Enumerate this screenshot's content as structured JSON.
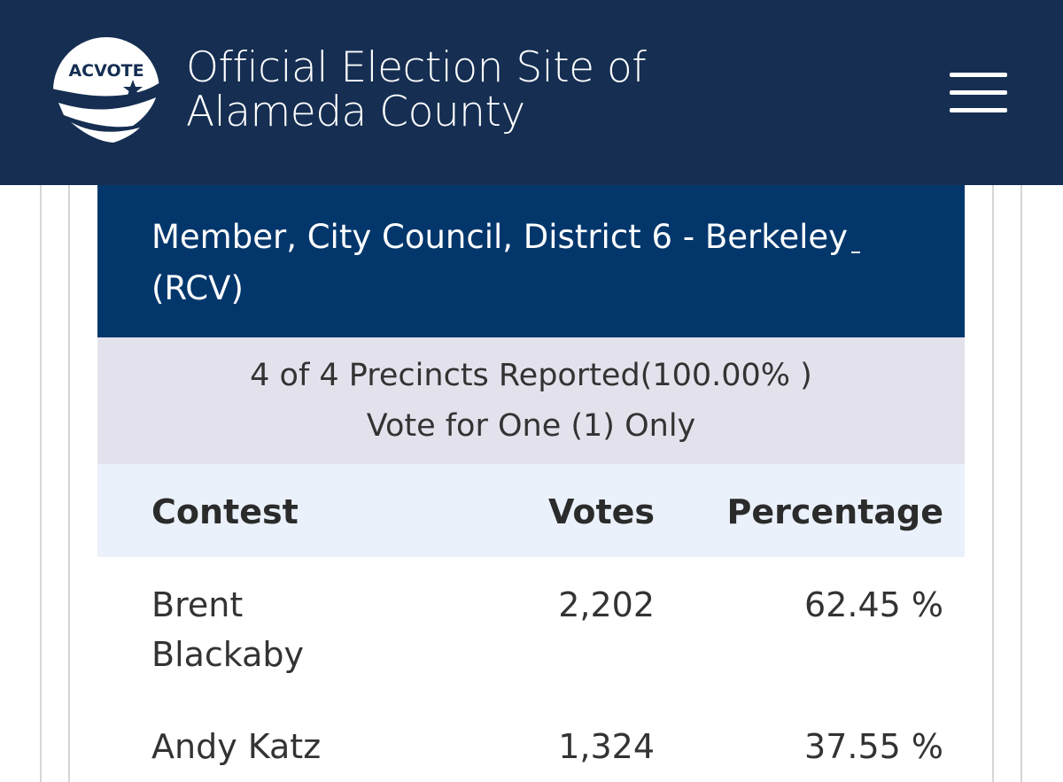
{
  "header": {
    "logo_text": "ACVOTE",
    "title_line1": "Official Election Site of",
    "title_line2": "Alameda County",
    "menu_icon": "hamburger-menu-icon"
  },
  "contest": {
    "title_line1": "Member, City Council, District 6 - Berkeley",
    "title_line2": "(RCV)",
    "precincts_reported": "4 of 4 Precincts Reported(100.00% )",
    "vote_instruction": "Vote for One (1) Only"
  },
  "table": {
    "columns": [
      "Contest",
      "Votes",
      "Percentage"
    ],
    "rows": [
      {
        "name": "Brent Blackaby",
        "votes": "2,202",
        "percentage": "62.45 %"
      },
      {
        "name": "Andy Katz",
        "votes": "1,324",
        "percentage": "37.55 %"
      }
    ]
  },
  "colors": {
    "header_bg": "#152e52",
    "contest_bg": "#03376c",
    "report_bg": "#e3e2ec",
    "table_head_bg": "#eaf1fa"
  }
}
